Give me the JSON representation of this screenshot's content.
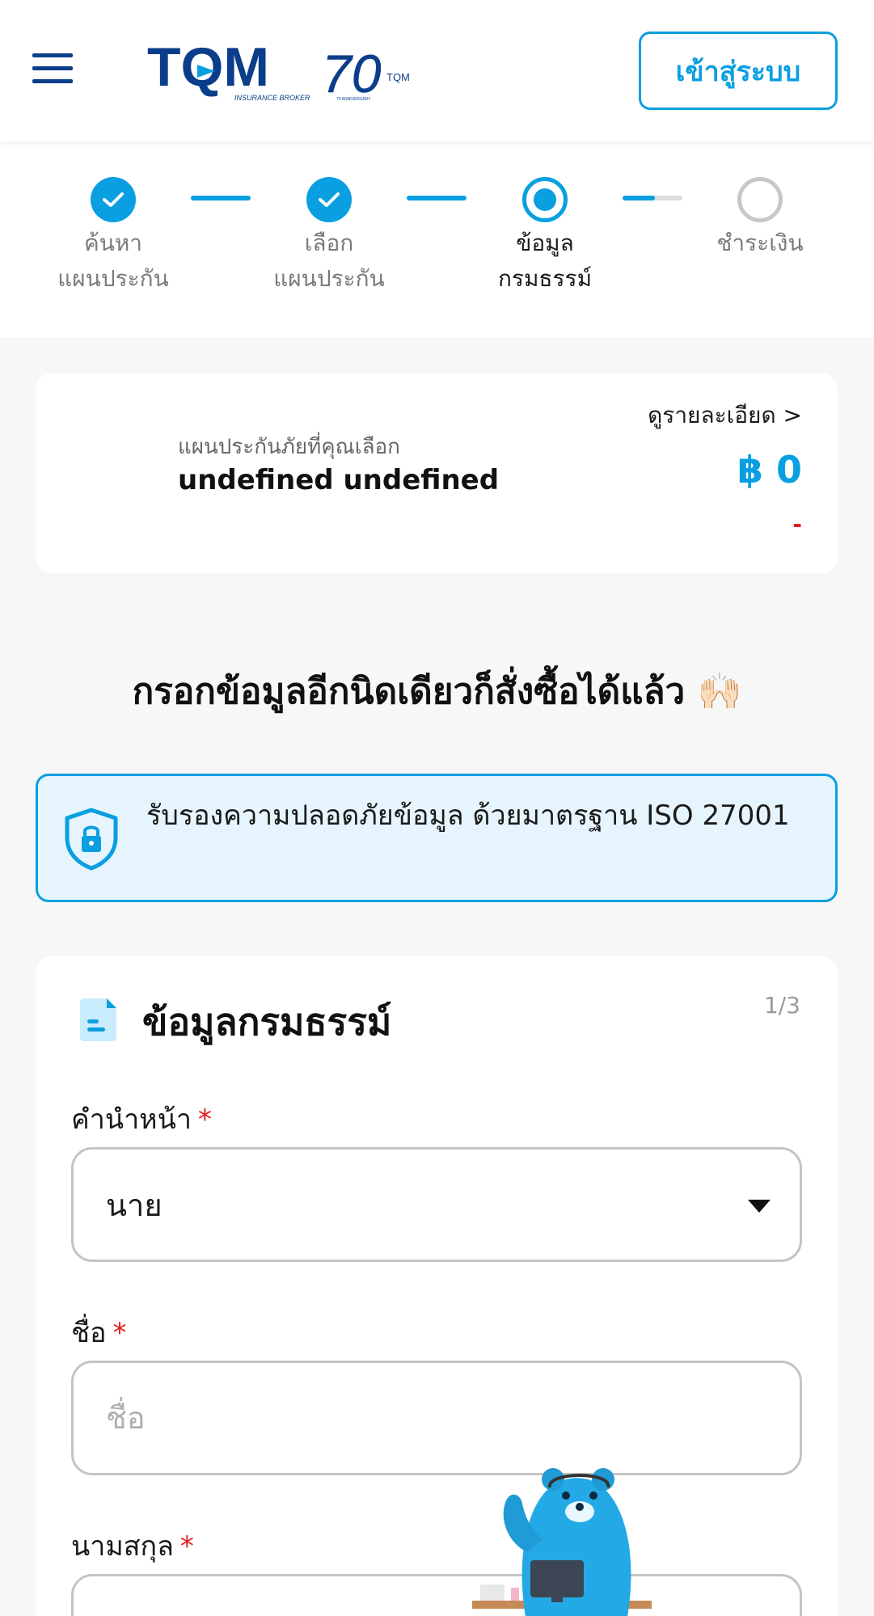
{
  "header": {
    "brand": "TQM",
    "brand_tagline": "INSURANCE BROKER",
    "anniversary_number": "70",
    "anniversary_brand": "TQM",
    "anniversary_tagline": "70 ANNIVERSARY",
    "login_label": "เข้าสู่ระบบ",
    "menu_icon": "hamburger-menu-icon"
  },
  "stepper": {
    "steps": [
      {
        "line1": "ค้นหา",
        "line2": "แผนประกัน",
        "status": "done"
      },
      {
        "line1": "เลือก",
        "line2": "แผนประกัน",
        "status": "done"
      },
      {
        "line1": "ข้อมูล",
        "line2": "กรมธรรม์",
        "status": "current"
      },
      {
        "line1": "ชำระเงิน",
        "line2": "",
        "status": "todo"
      }
    ],
    "accent_color": "#0a9fe0"
  },
  "plan": {
    "subtitle": "แผนประกันภัยที่คุณเลือก",
    "name": "undefined undefined",
    "detail_link": "ดูรายละเอียด >",
    "price": "฿ 0",
    "price_note": "-"
  },
  "headline": {
    "text": "กรอกข้อมูลอีกนิดเดียวก็สั่งซื้อได้แล้ว",
    "emoji": "🙌🏻"
  },
  "security_banner": {
    "text": "รับรองความปลอดภัยข้อมูล ด้วยมาตรฐาน ISO 27001",
    "icon": "shield-lock-icon"
  },
  "form": {
    "title": "ข้อมูลกรมธรรม์",
    "step_indicator": "1/3",
    "fields": {
      "title_prefix": {
        "label": "คำนำหน้า",
        "required_mark": "*",
        "value": "นาย"
      },
      "first_name": {
        "label": "ชื่อ",
        "required_mark": "*",
        "placeholder": "ชื่อ"
      },
      "last_name": {
        "label": "นามสกุล",
        "required_mark": "*"
      }
    }
  }
}
